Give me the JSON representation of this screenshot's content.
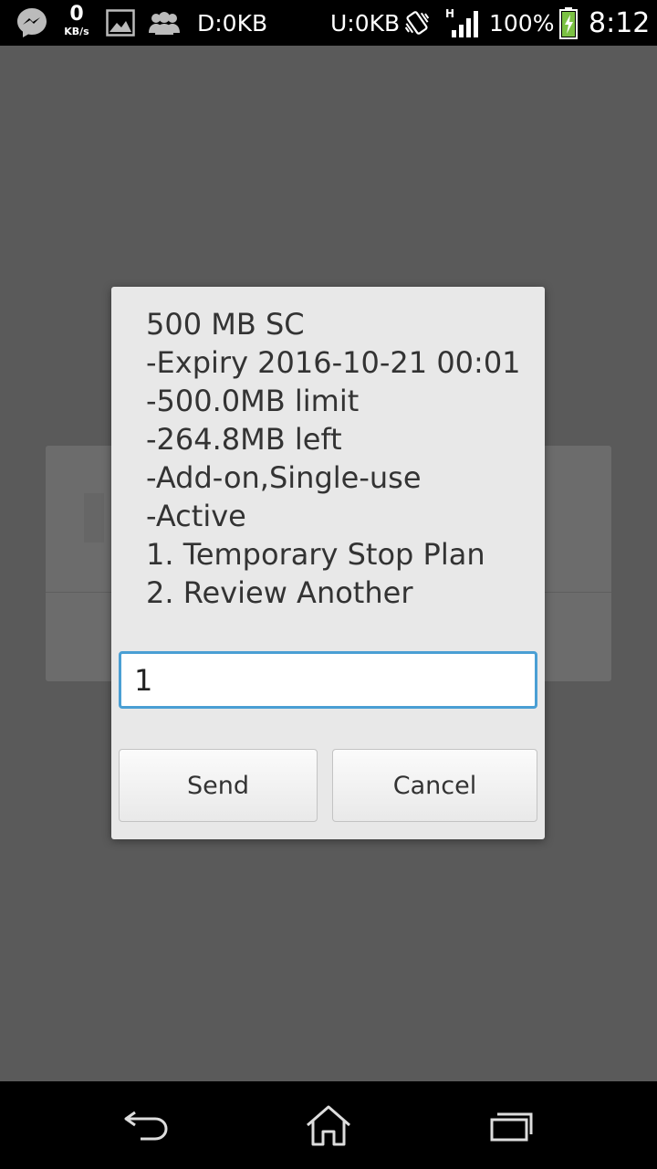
{
  "status_bar": {
    "speed_value": "0",
    "speed_unit": "KB/s",
    "download": "D:0KB",
    "upload": "U:0KB",
    "network_type": "H",
    "battery": "100%",
    "time": "8:12",
    "icons": [
      "messenger-icon",
      "image-icon",
      "people-icon",
      "vibrate-icon",
      "signal-icon",
      "battery-charging-icon"
    ]
  },
  "dialog": {
    "message_lines": [
      "500 MB SC",
      "-Expiry 2016-10-21 00:01",
      "-500.0MB limit",
      "-264.8MB left",
      "-Add-on,Single-use",
      "-Active",
      "1. Temporary Stop Plan",
      "2. Review Another"
    ],
    "input_value": "1",
    "send_label": "Send",
    "cancel_label": "Cancel"
  },
  "nav_bar": {
    "icons": [
      "back-icon",
      "home-icon",
      "recent-apps-icon"
    ]
  }
}
